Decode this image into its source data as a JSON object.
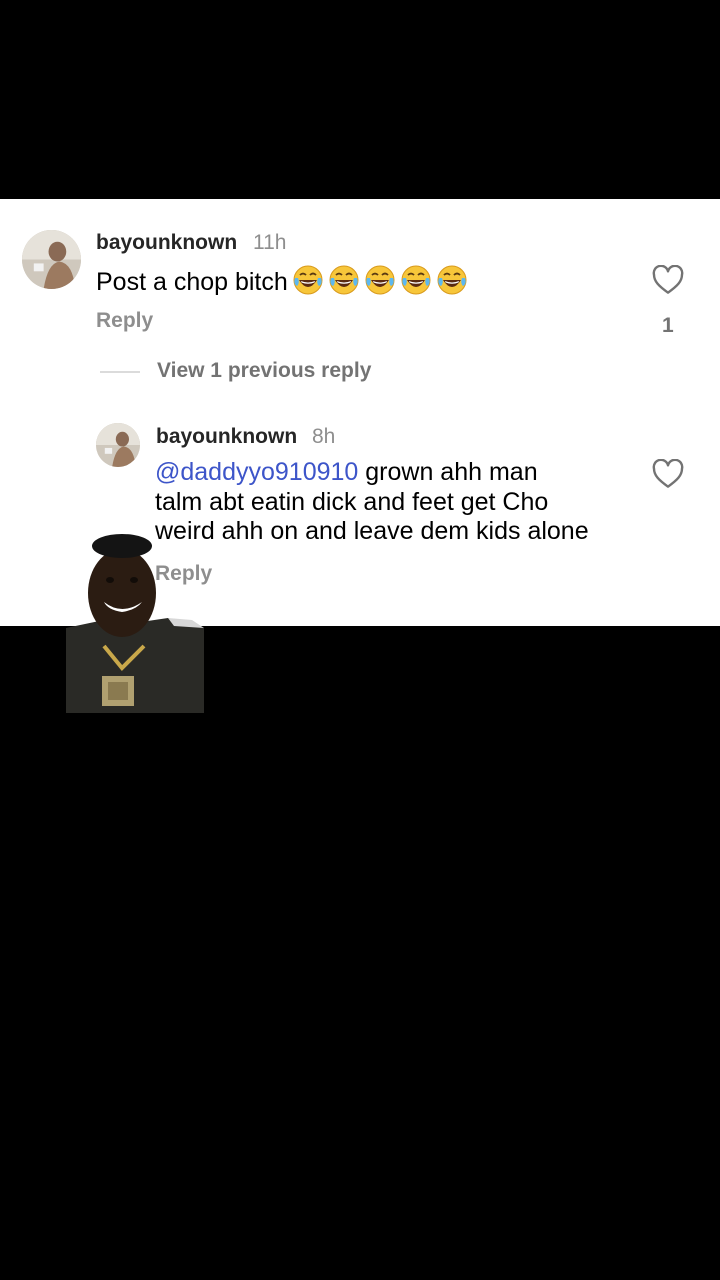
{
  "comment": {
    "username": "bayounknown",
    "time": "11h",
    "text": "Post a chop bitch",
    "emoji_count": 5,
    "reply_label": "Reply",
    "like_count": "1"
  },
  "view_previous": "View 1 previous reply",
  "reply": {
    "username": "bayounknown",
    "time": "8h",
    "mention": "@daddyyo910910",
    "text_line1": " grown ahh man",
    "text_line2": "talm abt eatin dick and feet get Cho",
    "text_line3": "weird ahh on and leave dem kids alone",
    "reply_label": "Reply"
  },
  "colors": {
    "mention": "#3d55c9",
    "muted": "#8e8e8e",
    "background": "#000000",
    "panel": "#ffffff"
  }
}
